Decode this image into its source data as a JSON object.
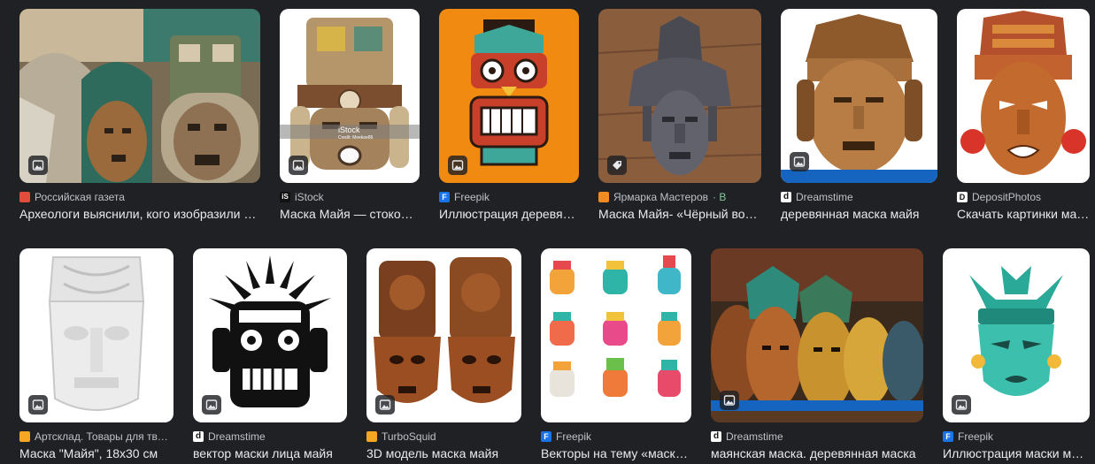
{
  "results": [
    {
      "source": "Российская газета",
      "title": "Археологи выяснили, кого изобразили на древних масках майя",
      "favicon": "rg-icon",
      "badge": "image-icon"
    },
    {
      "source": "iStock",
      "title": "Маска Майя — стоковые фотографии и другие картинки",
      "favicon": "istock-icon",
      "badge": "image-icon"
    },
    {
      "source": "Freepik",
      "title": "Иллюстрация деревянной маски",
      "favicon": "freepik-icon",
      "badge": "image-icon"
    },
    {
      "source": "Ярмарка Мастеров",
      "source_extra": "· В",
      "title": "Маска Майя- «Чёрный воин»",
      "favicon": "livemaster-icon",
      "badge": "tag-icon"
    },
    {
      "source": "Dreamstime",
      "title": "деревянная маска майя",
      "favicon": "dreamstime-icon",
      "badge": "image-icon"
    },
    {
      "source": "DepositPhotos",
      "title": "Скачать картинки маска майя",
      "favicon": "depositphotos-icon",
      "badge": "image-icon"
    },
    {
      "source": "Артсклад. Товары для творчества",
      "title": "Маска \"Майя\", 18х30 см",
      "favicon": "artsklad-icon",
      "badge": "image-icon"
    },
    {
      "source": "Dreamstime",
      "title": "вектор маски лица майя",
      "favicon": "dreamstime-icon",
      "badge": "image-icon"
    },
    {
      "source": "TurboSquid",
      "title": "3D модель маска майя",
      "favicon": "turbosquid-icon",
      "badge": "image-icon"
    },
    {
      "source": "Freepik",
      "title": "Векторы на тему «маска майя»",
      "favicon": "freepik-icon",
      "badge": null
    },
    {
      "source": "Dreamstime",
      "title": "маянская маска. деревянная маска",
      "favicon": "dreamstime-icon",
      "badge": "image-icon"
    },
    {
      "source": "Freepik",
      "title": "Иллюстрация маски майя",
      "favicon": "freepik-icon",
      "badge": "image-icon"
    }
  ],
  "image_watermarks": {
    "istock": "iStock",
    "istock_credit": "Credit: Meekoe86"
  },
  "colors": {
    "background": "#202124",
    "title_text": "#e8eaed",
    "source_text": "#bdc1c6"
  }
}
